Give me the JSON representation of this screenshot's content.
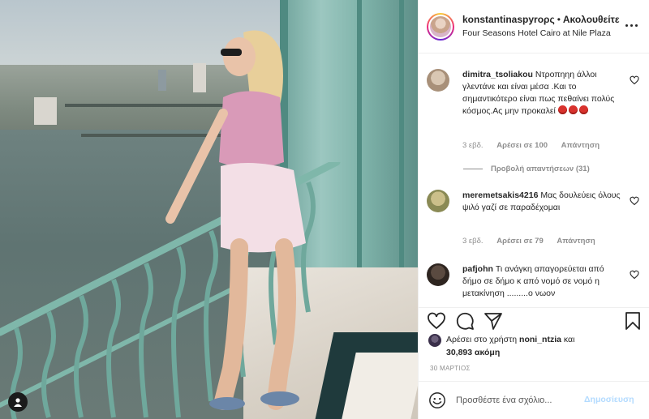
{
  "header": {
    "username": "konstantinaspyrορς",
    "separator": "•",
    "follow_label": "Ακολουθείτε",
    "location": "Four Seasons Hotel Cairo at Nile Plaza"
  },
  "comments": [
    {
      "username": "dimitra_tsoliakou",
      "text": "Ντροπηηη άλλοι γλεντάνε και είναι μέσα .Και το σημαντικότερο είναι πως πεθαίνει πολύς κόσμος.Ας μην προκαλεί",
      "emoji_count": 3,
      "time": "3 εβδ.",
      "likes": "Αρέσει σε 100",
      "reply_label": "Απάντηση"
    },
    {
      "username": "meremetsakis4216",
      "text": "Μας δουλεύεις όλους ψιλό γαζί σε παραδέχομαι",
      "time": "3 εβδ.",
      "likes": "Αρέσει σε 79",
      "reply_label": "Απάντηση"
    },
    {
      "username": "pafjohn",
      "text": "Τι ανάγκη απαγορεύεται από δήμο σε δήμο κ από νομό σε νομό η μετακίνηση .........ο νωον"
    }
  ],
  "view_replies": "Προβολή απαντήσεων (31)",
  "likes_block": {
    "prefix": "Αρέσει στο χρήστη",
    "liker": "noni_ntzia",
    "joiner": "και",
    "count": "30,893 ακόμη"
  },
  "date": "30 ΜΑΡΤΙΟΣ",
  "add_comment": {
    "placeholder": "Προσθέστε ένα σχόλιο...",
    "post_label": "Δημοσίευση"
  },
  "icons": {
    "like": "heart-icon",
    "comment": "comment-icon",
    "share": "send-icon",
    "save": "bookmark-icon",
    "emoji": "smile-icon",
    "more": "more-icon",
    "user_tag": "user-tag-icon"
  },
  "colors": {
    "link_disabled": "#b3dbff",
    "meta_text": "#8e8e8e",
    "border": "#efefef"
  }
}
